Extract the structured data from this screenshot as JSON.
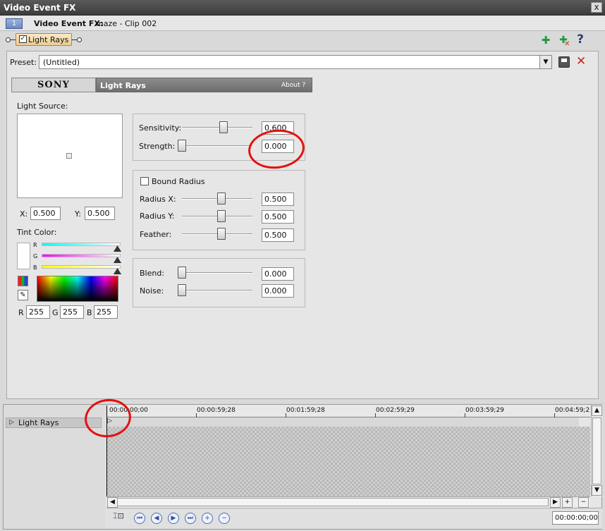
{
  "window": {
    "title": "Video Event FX",
    "close": "x"
  },
  "header": {
    "clip_number": "1",
    "label": "Video Event FX:",
    "clip_name": "maze - Clip 002"
  },
  "chain": {
    "plugin_label": "Light Rays",
    "checked": true
  },
  "toolbar": {
    "add_icon": "plugin-chain-add-icon",
    "remove_icon": "plugin-chain-remove-icon",
    "help": "?"
  },
  "preset": {
    "label": "Preset:",
    "value": "(Untitled)"
  },
  "plugin_header": {
    "brand": "SONY",
    "name": "Light Rays",
    "about": "About  ?"
  },
  "light_source": {
    "label": "Light Source:",
    "x_label": "X:",
    "x_value": "0.500",
    "y_label": "Y:",
    "y_value": "0.500"
  },
  "params": {
    "sensitivity": {
      "label": "Sensitivity:",
      "value": "0.600",
      "level": 0.6
    },
    "strength": {
      "label": "Strength:",
      "value": "0.000",
      "level": 0.0
    },
    "bound_radius": {
      "label": "Bound Radius",
      "checked": false
    },
    "radius_x": {
      "label": "Radius X:",
      "value": "0.500",
      "level": 0.5
    },
    "radius_y": {
      "label": "Radius Y:",
      "value": "0.500",
      "level": 0.5
    },
    "feather": {
      "label": "Feather:",
      "value": "0.500",
      "level": 0.5
    },
    "blend": {
      "label": "Blend:",
      "value": "0.000",
      "level": 0.0
    },
    "noise": {
      "label": "Noise:",
      "value": "0.000",
      "level": 0.0
    }
  },
  "tint": {
    "label": "Tint Color:",
    "r_label": "R",
    "g_label": "G",
    "b_label": "B",
    "r": "255",
    "g": "255",
    "b": "255",
    "rgb_r_label": "R",
    "rgb_g_label": "G",
    "rgb_b_label": "B"
  },
  "timeline": {
    "track_label": "Light Rays",
    "ticks": [
      "00:00:00;00",
      "00:00:59;28",
      "00:01:59;28",
      "00:02:59;29",
      "00:03:59;29",
      "00:04:59;2"
    ],
    "timecode": "00:00:00;00"
  },
  "colors": {
    "annotation": "#e31010",
    "accent": "#6c8ac4"
  }
}
